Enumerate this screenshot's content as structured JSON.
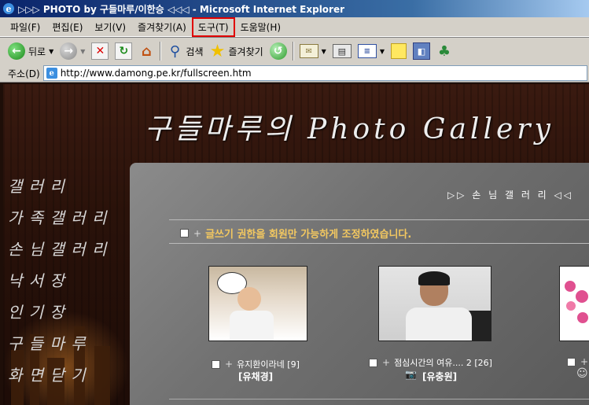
{
  "window": {
    "title": "▷▷▷ PHOTO by 구들마루/이한승 ◁◁◁ - Microsoft Internet Explorer"
  },
  "menu": [
    "파일(F)",
    "편집(E)",
    "보기(V)",
    "즐겨찾기(A)",
    "도구(T)",
    "도움말(H)"
  ],
  "toolbar": {
    "back_label": "뒤로",
    "search_label": "검색",
    "favorites_label": "즐겨찾기"
  },
  "address": {
    "label": "주소(D)",
    "url": "http://www.damong.pe.kr/fullscreen.htm"
  },
  "page": {
    "title": "구들마루의 Photo Gallery",
    "nav": [
      "갤 러 리",
      "가 족 갤 러 리",
      "손 님 갤 러 리",
      "낙 서 장",
      "인 기 장",
      "구 들 마 루",
      "화 면 닫 기"
    ],
    "section_title": "▷▷ 손 님 갤 러 리 ◁◁",
    "notice": "글쓰기 권한을 회원만 가능하게 조정하였습니다.",
    "photos": [
      {
        "caption": "유지환이라네 [9]",
        "author": "[유채경]"
      },
      {
        "caption": "점심시간의 여유.... 2 [26]",
        "author": "[유충원]"
      },
      {
        "caption": "",
        "author": ""
      }
    ]
  }
}
